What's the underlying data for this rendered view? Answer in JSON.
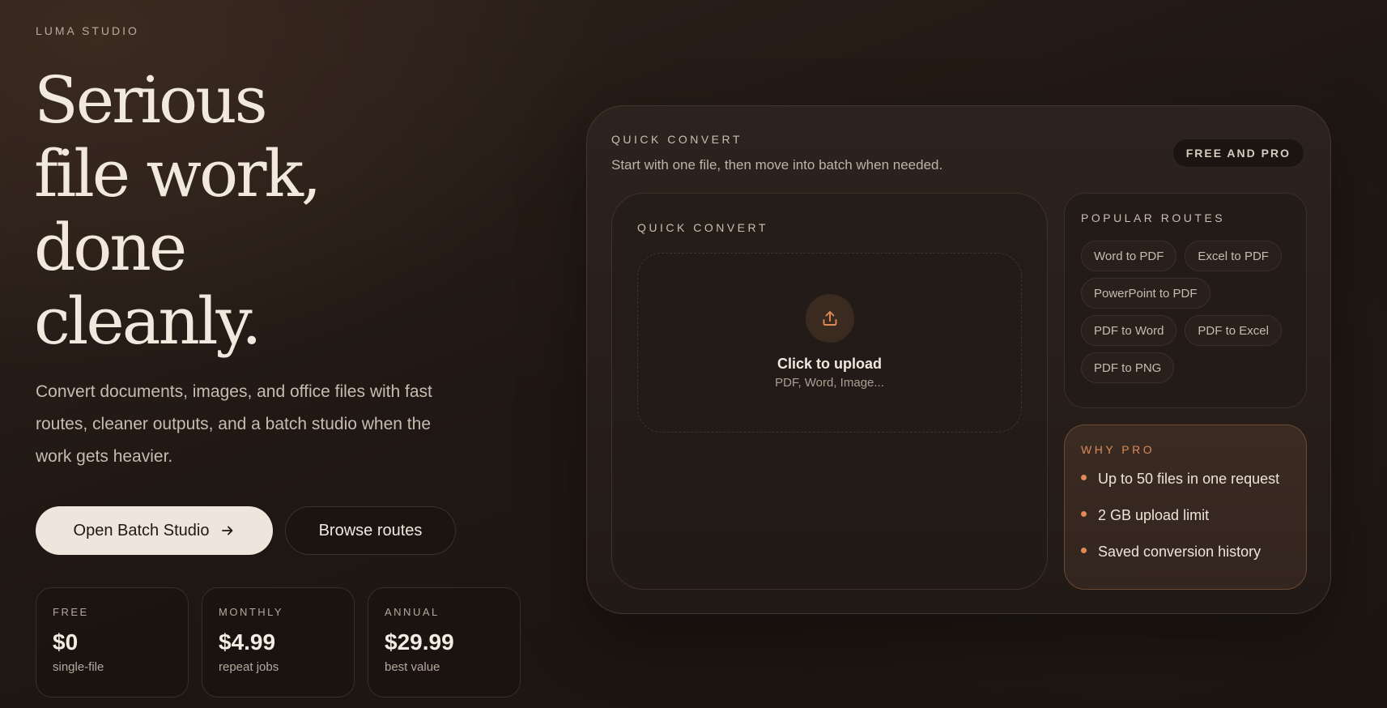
{
  "brand": "LUMA STUDIO",
  "hero": {
    "title_lines": [
      "Serious",
      "file work,",
      "done",
      "cleanly."
    ],
    "description": "Convert documents, images, and office files with fast routes, cleaner outputs, and a batch studio when the work gets heavier."
  },
  "actions": {
    "primary_label": "Open Batch Studio",
    "primary_icon": "arrow-right-icon",
    "secondary_label": "Browse routes"
  },
  "pricing": [
    {
      "tier": "FREE",
      "price": "$0",
      "note": "single-file"
    },
    {
      "tier": "MONTHLY",
      "price": "$4.99",
      "note": "repeat jobs"
    },
    {
      "tier": "ANNUAL",
      "price": "$29.99",
      "note": "best value"
    }
  ],
  "panel": {
    "eyebrow": "QUICK CONVERT",
    "subtitle": "Start with one file, then move into batch when needed.",
    "badge": "FREE AND PRO",
    "convert": {
      "eyebrow": "QUICK CONVERT",
      "upload_title": "Click to upload",
      "upload_sub": "PDF, Word, Image...",
      "upload_icon": "upload-icon"
    },
    "routes": {
      "title": "POPULAR ROUTES",
      "items": [
        "Word to PDF",
        "Excel to PDF",
        "PowerPoint to PDF",
        "PDF to Word",
        "PDF to Excel",
        "PDF to PNG"
      ]
    },
    "pro": {
      "title": "WHY PRO",
      "items": [
        "Up to 50 files in one request",
        "2 GB upload limit",
        "Saved conversion history"
      ]
    }
  },
  "colors": {
    "accent": "#e08a55",
    "background": "#1f1713",
    "primary_button": "#eee6dc"
  }
}
